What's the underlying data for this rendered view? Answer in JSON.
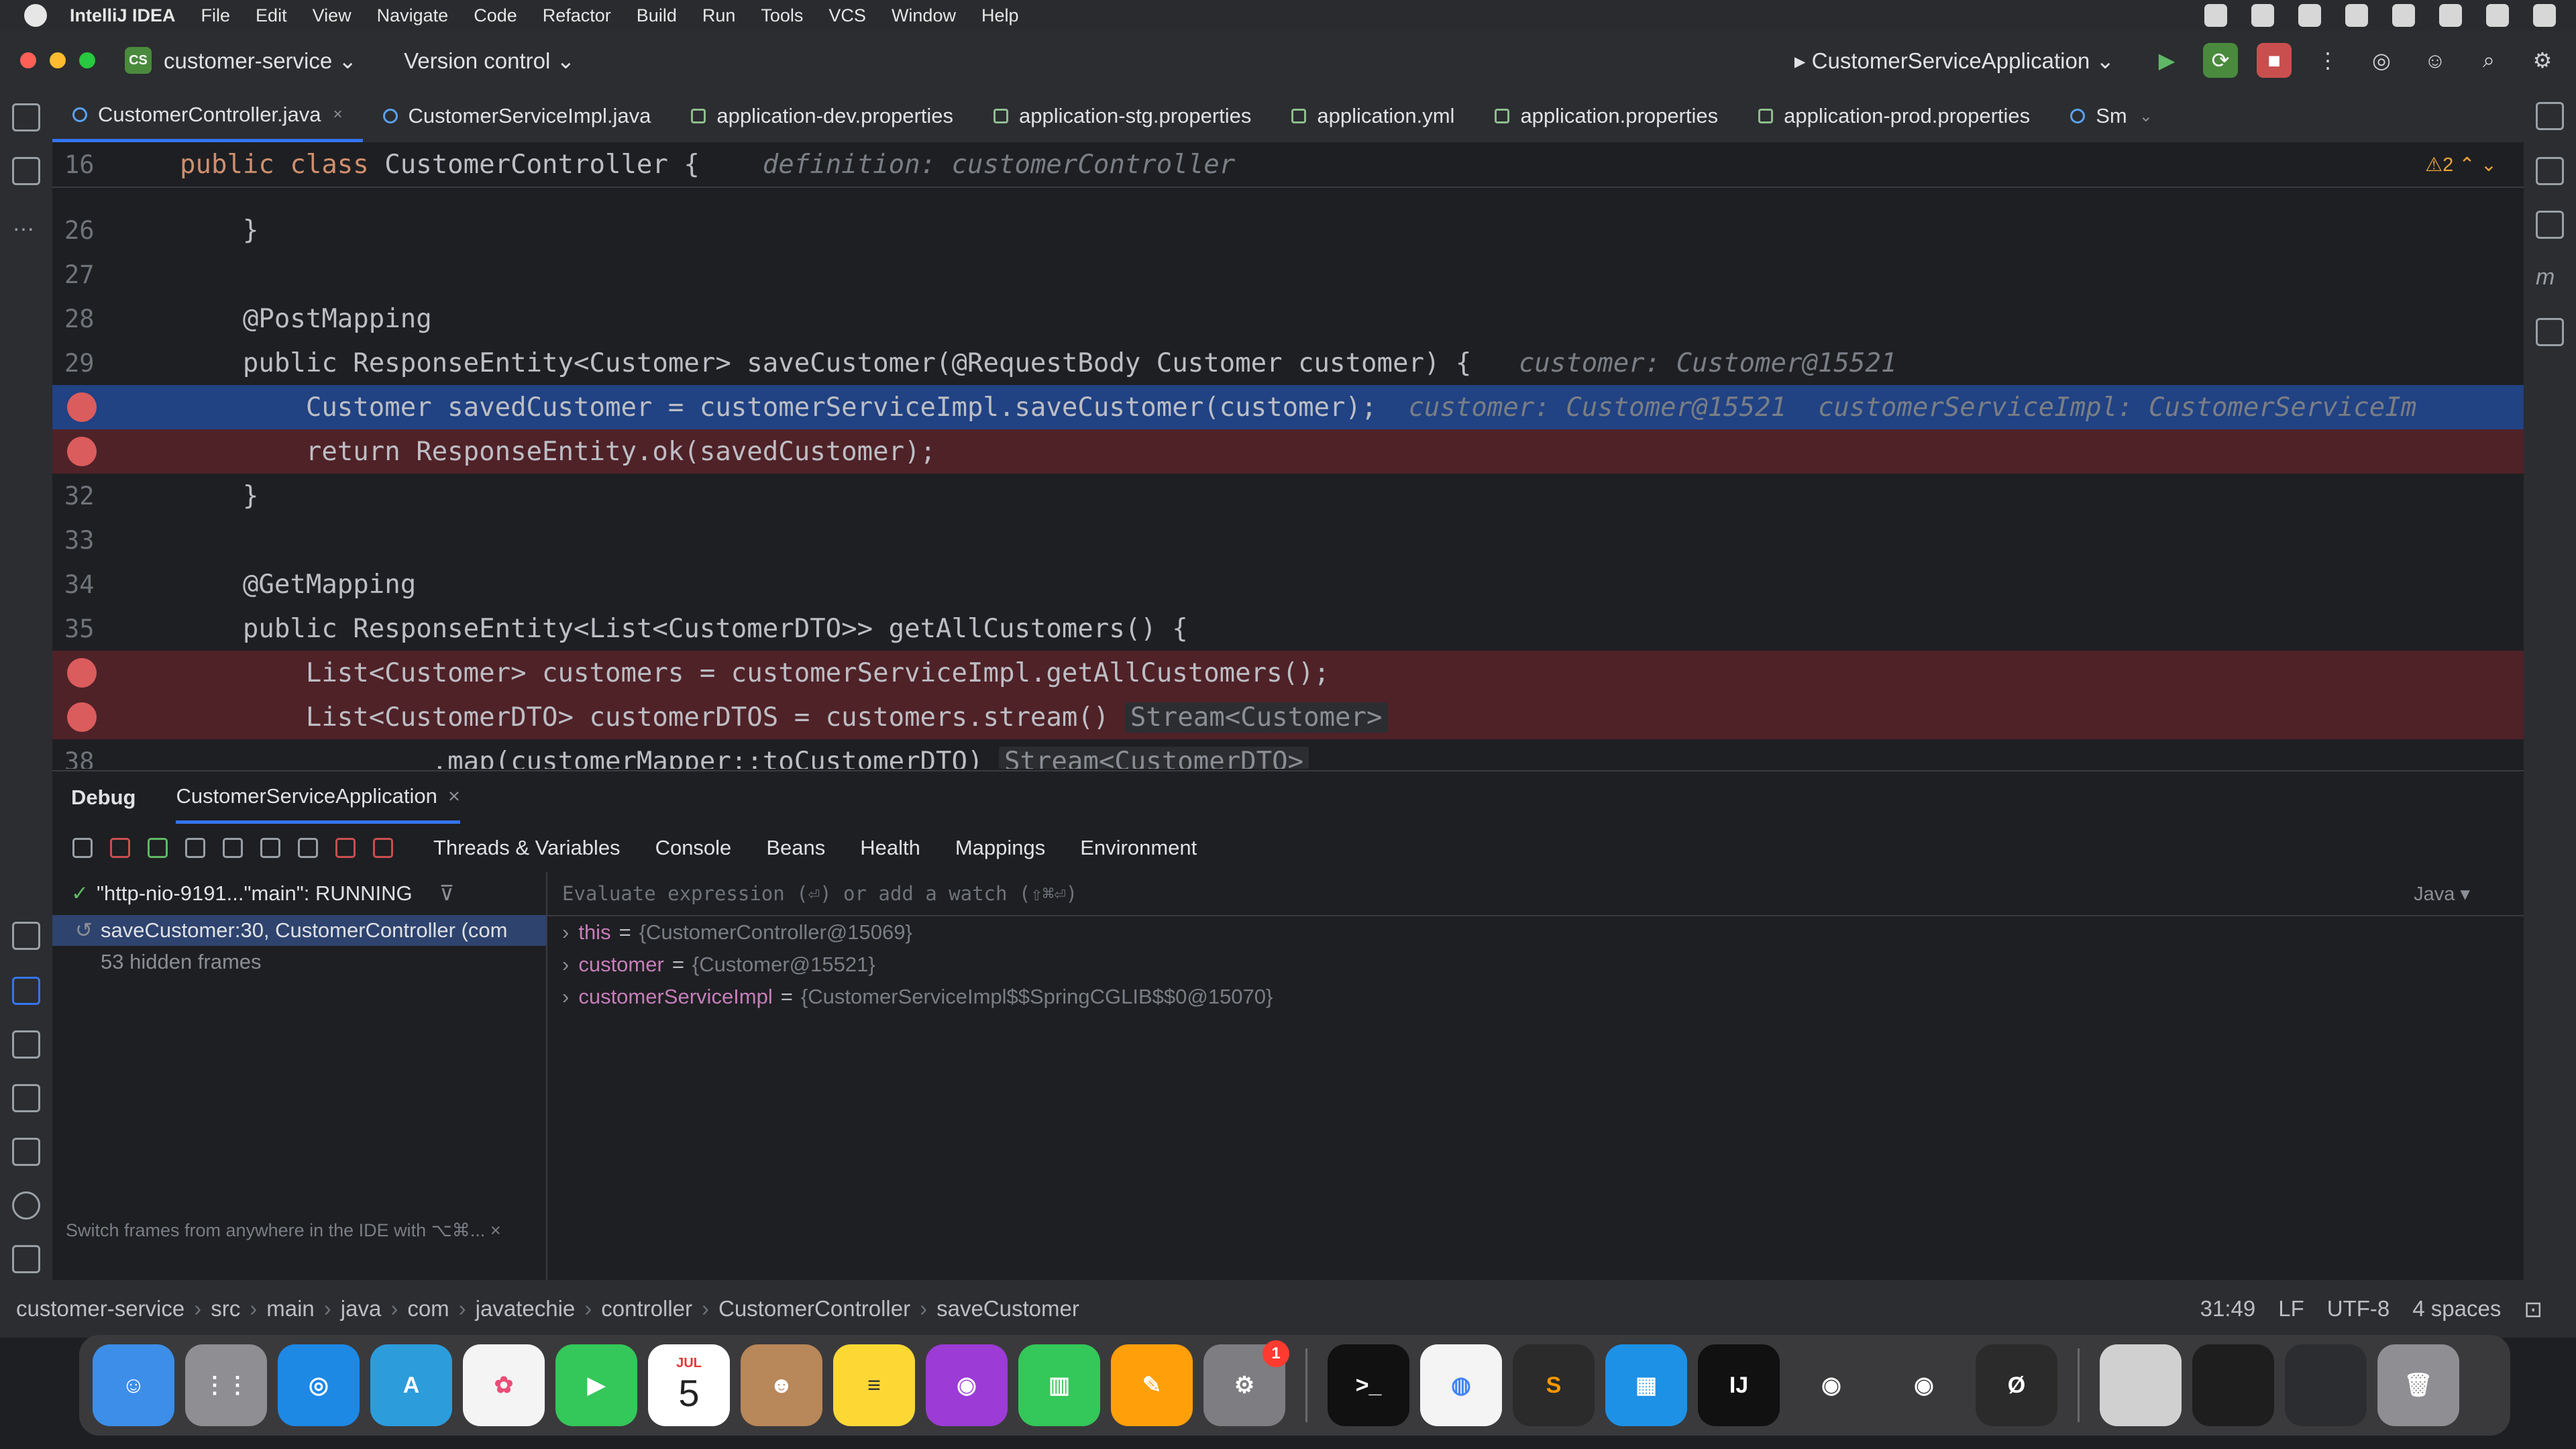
{
  "menubar": {
    "items": [
      "IntelliJ IDEA",
      "File",
      "Edit",
      "View",
      "Navigate",
      "Code",
      "Refactor",
      "Build",
      "Run",
      "Tools",
      "VCS",
      "Window",
      "Help"
    ]
  },
  "toolbar": {
    "project_badge": "CS",
    "project": "customer-service",
    "vcs": "Version control",
    "run_config": "CustomerServiceApplication"
  },
  "tabs": [
    {
      "label": "CustomerController.java",
      "active": true
    },
    {
      "label": "CustomerServiceImpl.java"
    },
    {
      "label": "application-dev.properties"
    },
    {
      "label": "application-stg.properties"
    },
    {
      "label": "application.yml"
    },
    {
      "label": "application.properties"
    },
    {
      "label": "application-prod.properties"
    },
    {
      "label": "Sm"
    }
  ],
  "editor": {
    "warnings": "2",
    "sticky": {
      "num": "16",
      "code": "public class CustomerController {",
      "hint": "definition: customerController"
    },
    "lines": [
      {
        "num": "26",
        "code": "    }"
      },
      {
        "num": "27",
        "code": ""
      },
      {
        "num": "28",
        "code": "    @PostMapping"
      },
      {
        "num": "29",
        "code": "    public ResponseEntity<Customer> saveCustomer(@RequestBody Customer customer) {",
        "hint": "customer: Customer@15521"
      },
      {
        "num": "",
        "code": "        Customer savedCustomer = customerServiceImpl.saveCustomer(customer);",
        "hint": "customer: Customer@15521",
        "hint2": "customerServiceImpl: CustomerServiceIm"
      },
      {
        "num": "",
        "code": "        return ResponseEntity.ok(savedCustomer);"
      },
      {
        "num": "32",
        "code": "    }"
      },
      {
        "num": "33",
        "code": ""
      },
      {
        "num": "34",
        "code": "    @GetMapping"
      },
      {
        "num": "35",
        "code": "    public ResponseEntity<List<CustomerDTO>> getAllCustomers() {"
      },
      {
        "num": "",
        "code": "        List<Customer> customers = customerServiceImpl.getAllCustomers();"
      },
      {
        "num": "",
        "code": "        List<CustomerDTO> customerDTOS = customers.stream()",
        "inlay": "Stream<Customer>"
      },
      {
        "num": "38",
        "code": "                .map(customerMapper::toCustomerDTO)",
        "inlay": "Stream<CustomerDTO>"
      }
    ]
  },
  "debug": {
    "title": "Debug",
    "session": "CustomerServiceApplication",
    "tabs": [
      "Threads & Variables",
      "Console",
      "Beans",
      "Health",
      "Mappings",
      "Environment"
    ],
    "thread": "\"http-nio-9191...\"main\": RUNNING",
    "frame": "saveCustomer:30, CustomerController (com",
    "hidden_frames": "53 hidden frames",
    "tip": "Switch frames from anywhere in the IDE with ⌥⌘... ×",
    "eval_placeholder": "Evaluate expression (⏎) or add a watch (⇧⌘⏎)",
    "eval_lang": "Java",
    "variables": [
      {
        "name": "this",
        "value": "{CustomerController@15069}"
      },
      {
        "name": "customer",
        "value": "{Customer@15521}"
      },
      {
        "name": "customerServiceImpl",
        "value": "{CustomerServiceImpl$$SpringCGLIB$$0@15070}"
      }
    ]
  },
  "statusbar": {
    "breadcrumb": [
      "customer-service",
      "src",
      "main",
      "java",
      "com",
      "javatechie",
      "controller",
      "CustomerController",
      "saveCustomer"
    ],
    "position": "31:49",
    "line_sep": "LF",
    "encoding": "UTF-8",
    "indent": "4 spaces"
  },
  "dock": {
    "calendar_month": "JUL",
    "calendar_day": "5",
    "settings_badge": "1"
  }
}
